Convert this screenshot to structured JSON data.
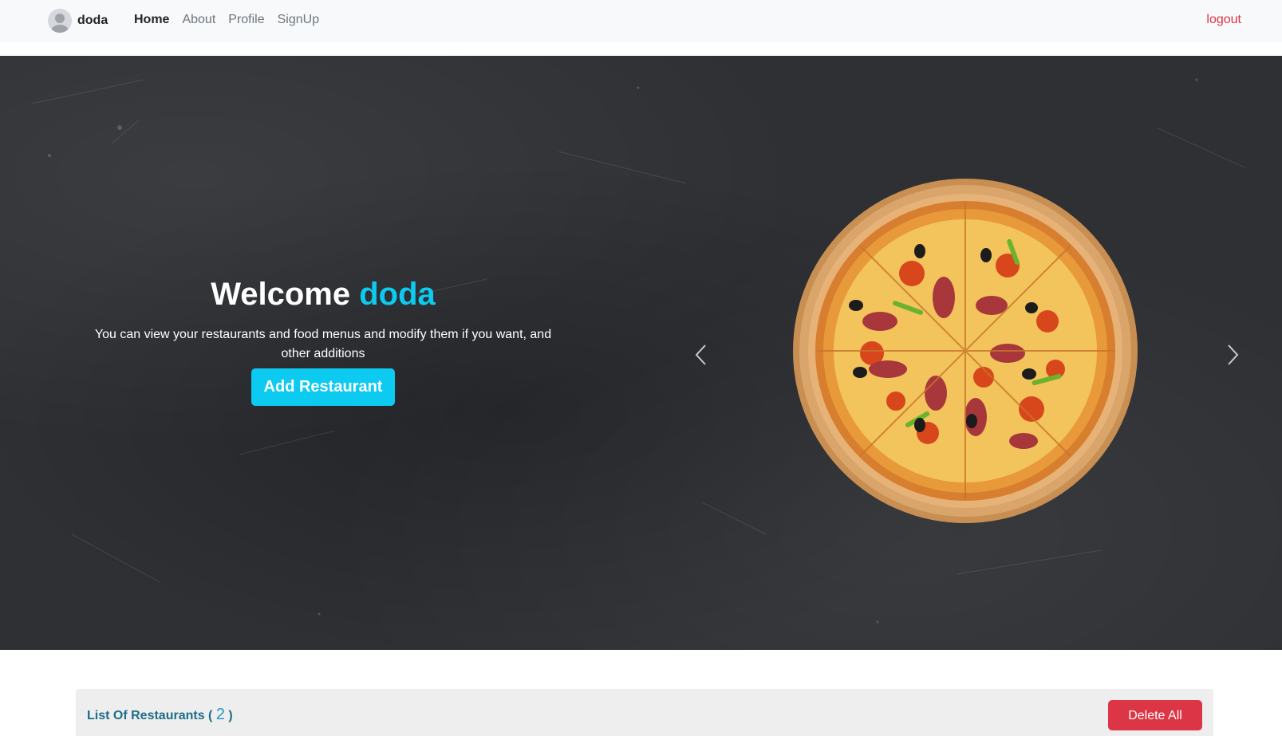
{
  "navbar": {
    "brand_name": "doda",
    "links": [
      {
        "label": "Home"
      },
      {
        "label": "About"
      },
      {
        "label": "Profile"
      },
      {
        "label": "SignUp"
      }
    ],
    "logout_label": "logout"
  },
  "hero": {
    "welcome_word": "Welcome",
    "username": "doda",
    "description": "You can view your restaurants and food menus and modify them if you want, and other additions",
    "add_button": "Add Restaurant",
    "prev_icon": "chevron-left-icon",
    "next_icon": "chevron-right-icon"
  },
  "list": {
    "title": "List Of Restaurants",
    "open_paren": "(",
    "count": "2",
    "close_paren": ")",
    "delete_all": "Delete All"
  },
  "colors": {
    "accent": "#0dcaf0",
    "danger": "#dc3545",
    "navbar_bg": "#f8f9fa",
    "hero_bg": "#2e3034"
  }
}
